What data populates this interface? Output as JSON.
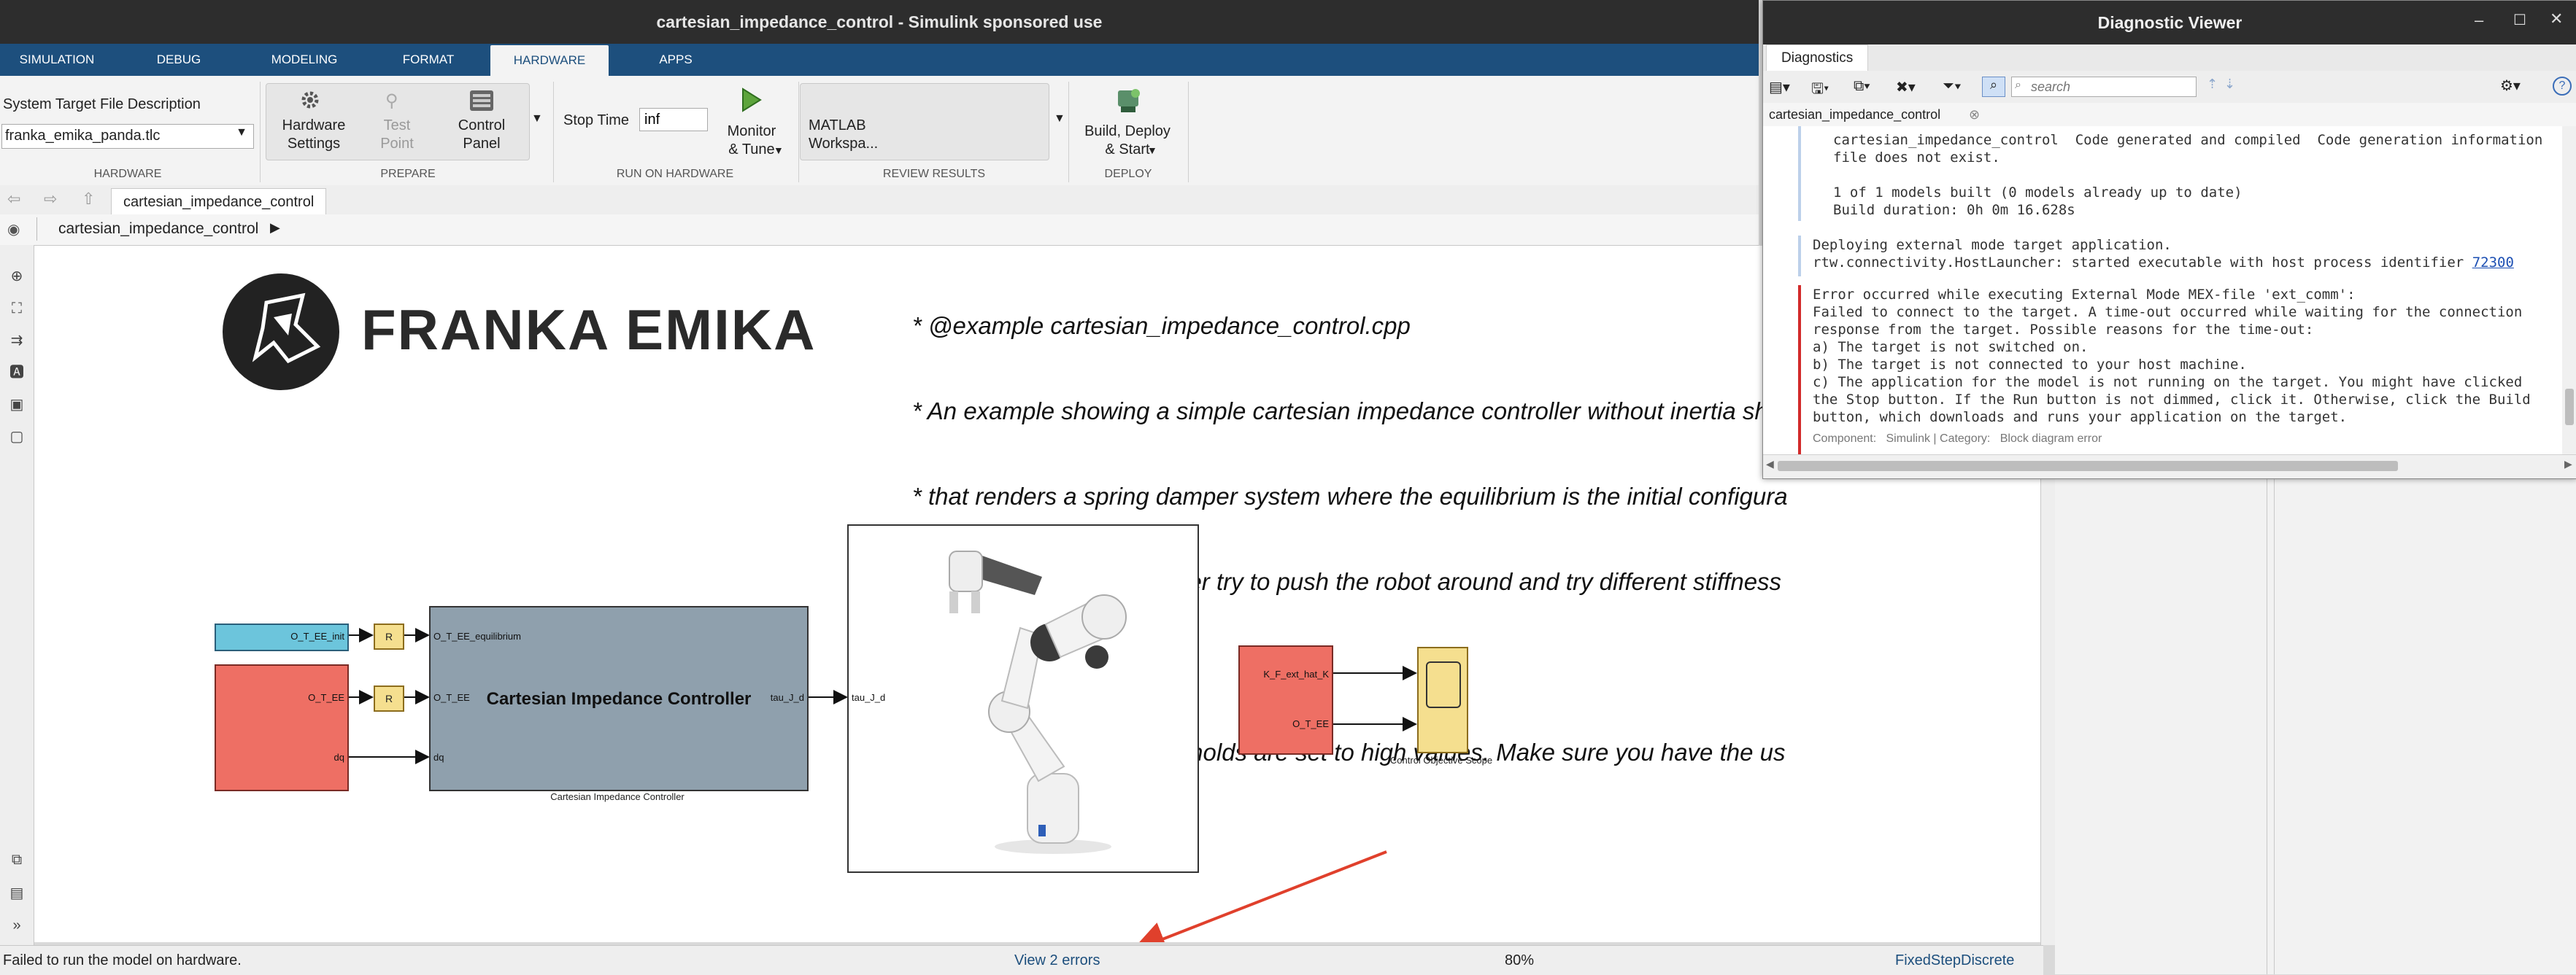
{
  "window": {
    "title": "cartesian_impedance_control - Simulink sponsored use"
  },
  "menu_tabs": [
    "SIMULATION",
    "DEBUG",
    "MODELING",
    "FORMAT",
    "HARDWARE",
    "APPS"
  ],
  "active_menu_tab": "HARDWARE",
  "toolstrip": {
    "stf_label": "System Target File Description",
    "stf_value": "franka_emika_panda.tlc",
    "hardware_settings": [
      "Hardware",
      "Settings"
    ],
    "test_point": [
      "Test",
      "Point"
    ],
    "control_panel": [
      "Control",
      "Panel"
    ],
    "stop_time_label": "Stop Time",
    "stop_time_value": "inf",
    "monitor_tune": [
      "Monitor",
      "& Tune"
    ],
    "matlab_workspace": [
      "MATLAB",
      "Workspa..."
    ],
    "build_deploy": [
      "Build, Deploy",
      "& Start"
    ],
    "sections": {
      "hardware": "HARDWARE",
      "prepare": "PREPARE",
      "run_on_hardware": "RUN ON HARDWARE",
      "review_results": "REVIEW RESULTS",
      "deploy": "DEPLOY"
    }
  },
  "model_tab": "cartesian_impedance_control",
  "breadcrumb": "cartesian_impedance_control",
  "canvas": {
    "logo_text": "FRANKA EMIKA",
    "comment_lines": [
      "* @example cartesian_impedance_control.cpp",
      "* An example showing a simple cartesian impedance controller without inertia sha",
      "* that renders a spring damper system where the equilibrium is the initial configura",
      "* After starting the controller try to push the robot around and try different stiffness",
      "*",
      "* @warning collision thresholds are set to high values. Make sure you have the us",
      "*/"
    ],
    "blocks": {
      "o_t_ee_init": "O_T_EE_init",
      "r1": "R",
      "r2": "R",
      "src_o_t_ee": "O_T_EE",
      "src_dq": "dq",
      "ctrl_in_eq": "O_T_EE_equilibrium",
      "ctrl_in_o": "O_T_EE",
      "ctrl_in_dq": "dq",
      "ctrl_title": "Cartesian Impedance Controller",
      "ctrl_out": "tau_J_d",
      "ctrl_caption": "Cartesian Impedance Controller",
      "robot_in": "tau_J_d",
      "red2_k": "K_F_ext_hat_K",
      "red2_o": "O_T_EE",
      "scope_caption": "Control Objective Scope"
    },
    "arrow_color": "#e0402c"
  },
  "status": {
    "left": "Failed to run the model on hardware.",
    "errors": "View 2 errors",
    "zoom": "80%",
    "solver": "FixedStepDiscrete"
  },
  "diagnostic_viewer": {
    "title": "Diagnostic Viewer",
    "tab": "Diagnostics",
    "search_placeholder": "search",
    "doc_tab": "cartesian_impedance_control",
    "lines": [
      "cartesian_impedance_control  Code generated and compiled  Code generation information",
      "file does not exist.",
      "",
      "1 of 1 models built (0 models already up to date)",
      "Build duration: 0h 0m 16.628s"
    ],
    "deploy_lines": [
      "Deploying external mode target application.",
      "rtw.connectivity.HostLauncher: started executable with host process identifier "
    ],
    "pid": "72300",
    "error_lines": [
      "Error occurred while executing External Mode MEX-file 'ext_comm':",
      "Failed to connect to the target. A time-out occurred while waiting for the connection",
      "response from the target. Possible reasons for the time-out:",
      "a) The target is not switched on.",
      "b) The target is not connected to your host machine.",
      "c) The application for the model is not running on the target. You might have clicked",
      "the Stop button. If the Run button is not dimmed, click it. Otherwise, click the Build",
      "button, which downloads and runs your application on the target."
    ],
    "component": "Component:   Simulink | Category:   Block diagram error"
  }
}
